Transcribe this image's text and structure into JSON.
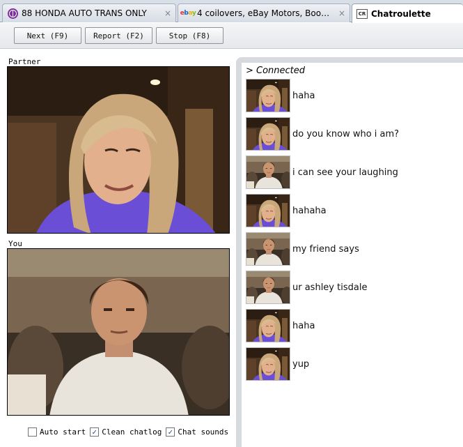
{
  "tabs": [
    {
      "title": "88 HONDA AUTO TRANS ONLY",
      "icon": "peace-sign-icon",
      "close": "×",
      "active": false
    },
    {
      "title": "4 coilovers, eBay Motors, Books. Gr...",
      "icon": "ebay-icon",
      "close": "×",
      "active": false
    },
    {
      "title": "Chatroulette",
      "icon": "chatroulette-icon",
      "favicon_text": "CR",
      "active": true
    }
  ],
  "ebay_logo": {
    "e": "e",
    "b": "b",
    "a": "a",
    "y": "y"
  },
  "toolbar": {
    "next_label": "Next (F9)",
    "report_label": "Report (F2)",
    "stop_label": "Stop (F8)"
  },
  "partner_label": "Partner",
  "you_label": "You",
  "options": {
    "auto_start": {
      "label": "Auto start",
      "checked": false
    },
    "clean_chatlog": {
      "label": "Clean chatlog",
      "checked": true
    },
    "chat_sounds": {
      "label": "Chat sounds",
      "checked": true
    },
    "check_mark": "✓"
  },
  "chat": {
    "status": "> Connected",
    "messages": [
      {
        "sender": "partner",
        "text": "haha"
      },
      {
        "sender": "partner",
        "text": "do you know who i am?"
      },
      {
        "sender": "you",
        "text": "i can see your laughing"
      },
      {
        "sender": "partner",
        "text": "hahaha"
      },
      {
        "sender": "you",
        "text": "my friend says"
      },
      {
        "sender": "you",
        "text": "ur ashley tisdale"
      },
      {
        "sender": "partner",
        "text": "haha"
      },
      {
        "sender": "partner",
        "text": "yup"
      }
    ]
  },
  "colors": {
    "chat_panel_bg": "#d6dadf",
    "partner_shirt": "#6a4fd6",
    "partner_hair": "#c9a77a",
    "you_shirt": "#e8e4dc"
  }
}
